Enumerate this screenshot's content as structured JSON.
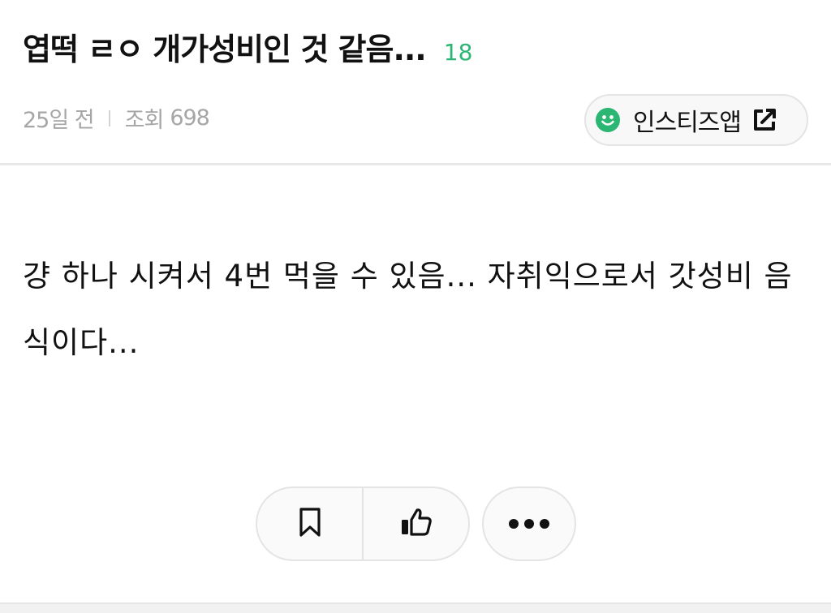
{
  "post": {
    "title": "엽떡 ㄹㅇ 개가성비인 것 같음...",
    "comment_count": "18",
    "time_ago": "25일 전",
    "views_label": "조회",
    "views_count": "698",
    "body": "걍 하나 시켜서 4번 먹을 수 있음... 자취익으로서 갓성비 음식이다..."
  },
  "app_button": {
    "label": "인스티즈앱",
    "icon": "smile-icon",
    "external_icon": "external-link-icon"
  },
  "actions": {
    "bookmark_icon": "bookmark-icon",
    "like_icon": "thumbs-up-icon",
    "more_icon": "more-dots-icon"
  },
  "colors": {
    "accent": "#2bb673",
    "meta_text": "#a6a6a6",
    "border": "#e4e4e4"
  }
}
